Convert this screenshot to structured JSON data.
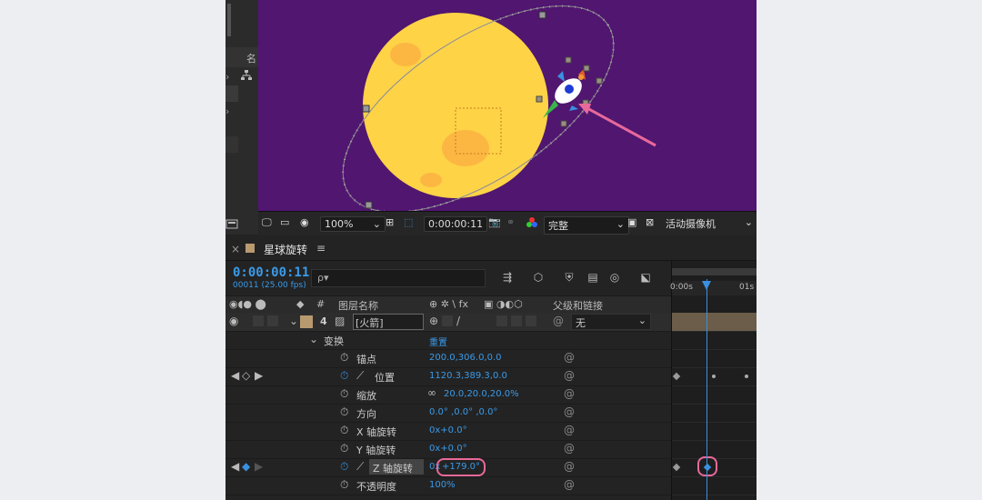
{
  "project_panel": {
    "column_header": "名"
  },
  "viewer": {
    "zoom": "100%",
    "timecode": "0:00:00:11",
    "resolution": "完整",
    "camera": "活动摄像机",
    "colors": {
      "background": "#501670",
      "planet": "#fed346",
      "spot": "#fcb743"
    }
  },
  "composition": {
    "tab_close": "×",
    "name": "星球旋转",
    "menu": "≡"
  },
  "timeline_header": {
    "timecode": "0:00:00:11",
    "frames": "00011 (25.00 fps)",
    "search_placeholder": "ρ▾"
  },
  "columns": {
    "number": "#",
    "layer_name": "图层名称",
    "switches": "⊕ ✲ \\ fx",
    "parent": "父级和链接"
  },
  "layer": {
    "index": "4",
    "name": "[火箭]",
    "parent_value": "无"
  },
  "transform": {
    "label": "变换",
    "reset": "重置",
    "properties": [
      {
        "name": "锚点",
        "value": "200.0,306.0,0.0"
      },
      {
        "name": "位置",
        "value": "1120.3,389.3,0.0"
      },
      {
        "name": "缩放",
        "value": "20.0,20.0,20.0%"
      },
      {
        "name": "方向",
        "value": "0.0°  ,0.0°  ,0.0°"
      },
      {
        "name": "X 轴旋转",
        "value": "0x+0.0°"
      },
      {
        "name": "Y 轴旋转",
        "value": "0x+0.0°"
      },
      {
        "name": "Z 轴旋转",
        "value_prefix": "0x",
        "value": "+179.0°"
      },
      {
        "name": "不透明度",
        "value": "100%"
      }
    ]
  },
  "timeline": {
    "ruler_start": "0:00s",
    "ruler_1s": "01s"
  },
  "highlight_color": "#e8699a"
}
